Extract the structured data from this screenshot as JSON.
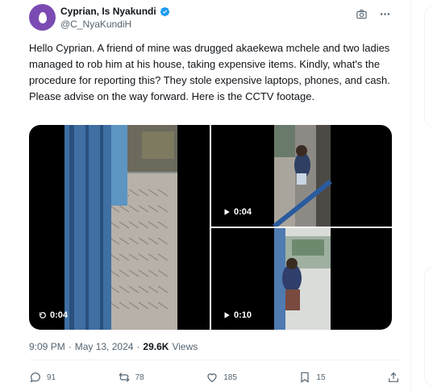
{
  "author": {
    "display_name": "Cyprian, Is Nyakundi",
    "handle": "@C_NyaKundiH"
  },
  "tweet": {
    "text": "Hello Cyprian. A friend of mine was drugged akaekewa mchele and two ladies managed to rob him at his house, taking expensive items. Kindly, what's the procedure for reporting this? They stole expensive laptops, phones, and cash. Please advise on the way forward. Here is the CCTV footage."
  },
  "media": {
    "videos": [
      {
        "duration": "0:04",
        "icon": "replay-icon"
      },
      {
        "duration": "0:04",
        "icon": "play-icon"
      },
      {
        "duration": "0:10",
        "icon": "play-icon"
      }
    ]
  },
  "meta": {
    "time": "9:09 PM",
    "separator": "·",
    "date": "May 13, 2024",
    "separator2": "·",
    "views_count": "29.6K",
    "views_label": "Views"
  },
  "actions": {
    "replies": "91",
    "reposts": "78",
    "likes": "185",
    "bookmarks": "15"
  },
  "colors": {
    "verified_blue": "#1d9bf0",
    "secondary_text": "#536471"
  }
}
